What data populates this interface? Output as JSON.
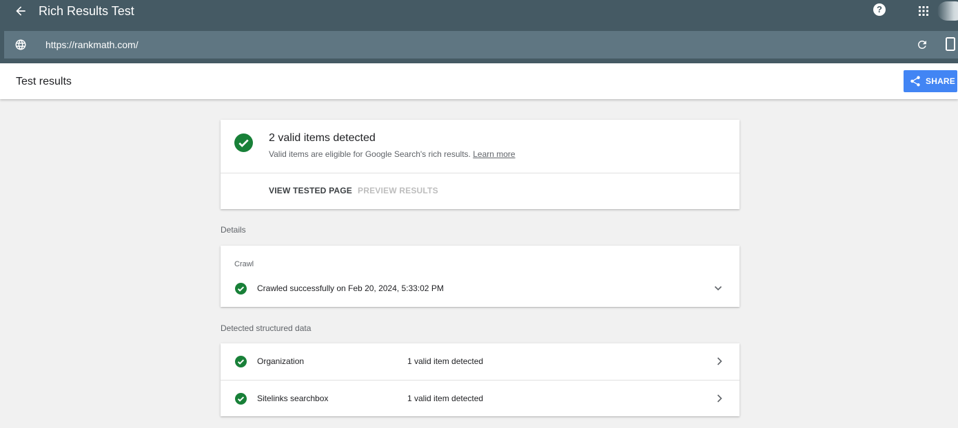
{
  "appbar": {
    "title": "Rich Results Test",
    "url": "https://rankmath.com/",
    "help_glyph": "?",
    "icons": [
      "back-arrow-icon",
      "help-icon",
      "apps-grid-icon",
      "globe-icon",
      "reload-icon",
      "mobile-device-icon"
    ]
  },
  "header": {
    "title": "Test results",
    "share_label": "SHARE"
  },
  "summary": {
    "title": "2 valid items detected",
    "subtitle": "Valid items are eligible for Google Search's rich results.",
    "learn_more": "Learn more",
    "view_tested_page": "VIEW TESTED PAGE",
    "preview_results": "PREVIEW RESULTS"
  },
  "details": {
    "section_label": "Details",
    "crawl_label": "Crawl",
    "crawl_status": "Crawled successfully on Feb 20, 2024, 5:33:02 PM"
  },
  "detected": {
    "section_label": "Detected structured data",
    "items": [
      {
        "name": "Organization",
        "status": "1 valid item detected"
      },
      {
        "name": "Sitelinks searchbox",
        "status": "1 valid item detected"
      }
    ]
  },
  "colors": {
    "appbar": "#455a64",
    "urlbar": "#5f7682",
    "success_green": "#188038",
    "share_blue": "#4285f4",
    "background": "#f1f1f1"
  }
}
